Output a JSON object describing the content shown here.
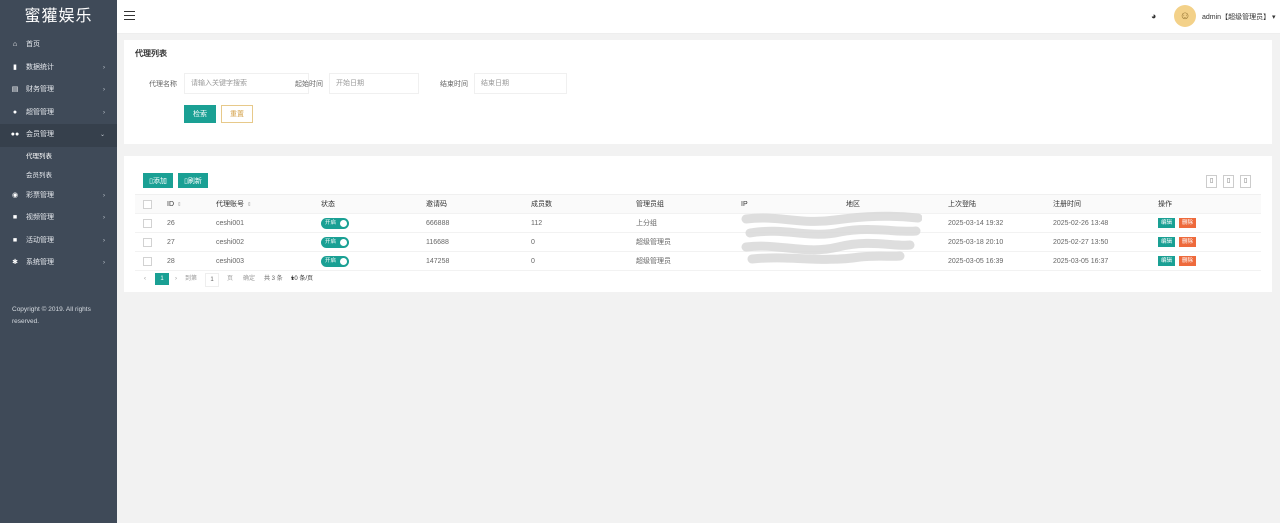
{
  "sidebar": {
    "brand": "蜜獾娱乐",
    "items": [
      {
        "label": "首页",
        "icon": "home-icon",
        "glyph": "⌂",
        "arrow": false
      },
      {
        "label": "数据统计",
        "icon": "chart-icon",
        "glyph": "▮",
        "arrow": true
      },
      {
        "label": "财务管理",
        "icon": "bank-icon",
        "glyph": "▤",
        "arrow": true
      },
      {
        "label": "超管管理",
        "icon": "user-icon",
        "glyph": "●",
        "arrow": true
      },
      {
        "label": "会员管理",
        "icon": "users-icon",
        "glyph": "●●",
        "arrow": true,
        "expanded": true
      },
      {
        "label": "彩票管理",
        "icon": "gamepad-icon",
        "glyph": "◉",
        "arrow": true
      },
      {
        "label": "视频管理",
        "icon": "video-icon",
        "glyph": "■",
        "arrow": true
      },
      {
        "label": "活动管理",
        "icon": "flag-icon",
        "glyph": "■",
        "arrow": true
      },
      {
        "label": "系统管理",
        "icon": "gear-icon",
        "glyph": "✱",
        "arrow": true
      }
    ],
    "subitems": [
      "代理列表",
      "会员列表"
    ],
    "copyright": "Copyright © 2019. All rights reserved."
  },
  "header": {
    "user": "admin【超级管理员】",
    "caret": "▾",
    "theme_glyph": "◕",
    "avatar_glyph": "☺"
  },
  "filter": {
    "title": "代理列表",
    "name_label": "代理名称",
    "name_placeholder": "请输入关键字搜索",
    "start_label": "起始时间",
    "start_placeholder": "开始日期",
    "end_label": "结束时间",
    "end_placeholder": "结束日期",
    "search_label": "检索",
    "reset_label": "重置"
  },
  "toolbar": {
    "add_label": "添加",
    "refresh_label": "刷新",
    "btn_glyph": "▯"
  },
  "table": {
    "headers": [
      "",
      "ID",
      "代理账号",
      "状态",
      "邀请码",
      "成员数",
      "管理员组",
      "IP",
      "地区",
      "上次登陆",
      "注册时间",
      "操作"
    ],
    "sort_glyph": "⇕",
    "switch_label": "开启",
    "edit_label": "编辑",
    "delete_label": "删除",
    "rows": [
      {
        "id": "26",
        "account": "ceshi001",
        "code": "666888",
        "members": "112",
        "group": "上分组",
        "ip": "",
        "region": "",
        "last_login": "2025-03-14 19:32",
        "reg_time": "2025-02-26 13:48"
      },
      {
        "id": "27",
        "account": "ceshi002",
        "code": "116688",
        "members": "0",
        "group": "超级管理员",
        "ip": "",
        "region": "",
        "last_login": "2025-03-18 20:10",
        "reg_time": "2025-02-27 13:50"
      },
      {
        "id": "28",
        "account": "ceshi003",
        "code": "147258",
        "members": "0",
        "group": "超级管理员",
        "ip": "",
        "region": "",
        "last_login": "2025-03-05 16:39",
        "reg_time": "2025-03-05 16:37"
      }
    ]
  },
  "pagination": {
    "prev": "‹",
    "current": "1",
    "next": "›",
    "goto_label": "到第",
    "goto_value": "1",
    "page_unit": "页",
    "confirm": "确定",
    "total": "共 3 条",
    "per_page": "10 条/页"
  },
  "colors": {
    "accent": "#1aa094",
    "danger": "#ee6a3c",
    "sidebar": "#3f4a58"
  }
}
